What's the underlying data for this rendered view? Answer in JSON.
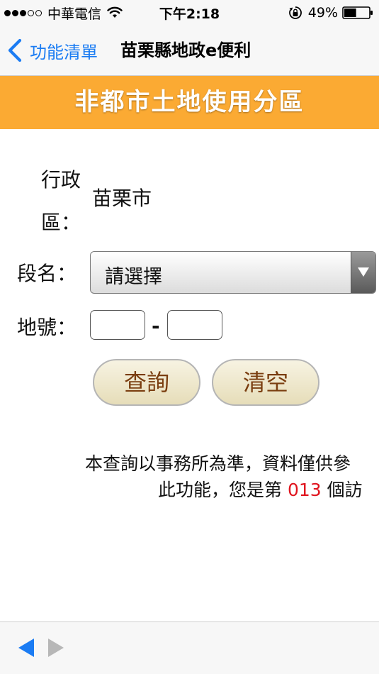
{
  "status_bar": {
    "carrier": "中華電信",
    "time": "下午2:18",
    "battery_percent": "49%",
    "battery_level": 0.49,
    "signal_bars_filled": 3,
    "signal_bars_total": 5
  },
  "nav": {
    "back_label": "功能清單",
    "title": "苗栗縣地政e便利",
    "accent_color": "#1b7cf3"
  },
  "banner": {
    "title": "非都市土地使用分區",
    "color": "#fbaa33"
  },
  "form": {
    "district_label_line1": "行政",
    "district_label_line2": "區：",
    "district_value": "苗栗市",
    "section_label": "段名：",
    "section_select_value": "請選擇",
    "lot_label": "地號：",
    "lot_separator": "-",
    "lot_main_value": "",
    "lot_sub_value": ""
  },
  "buttons": {
    "query": "查詢",
    "clear": "清空"
  },
  "notice": {
    "line1": "本查詢以事務所為準，資料僅供參",
    "line2_prefix": "此功能，您是第 ",
    "visit_count": "013",
    "line2_suffix": " 個訪",
    "count_color": "#e0141e"
  },
  "toolbar": {
    "back_arrow_icon": "left-arrow-icon",
    "forward_arrow_icon": "right-arrow-icon"
  }
}
